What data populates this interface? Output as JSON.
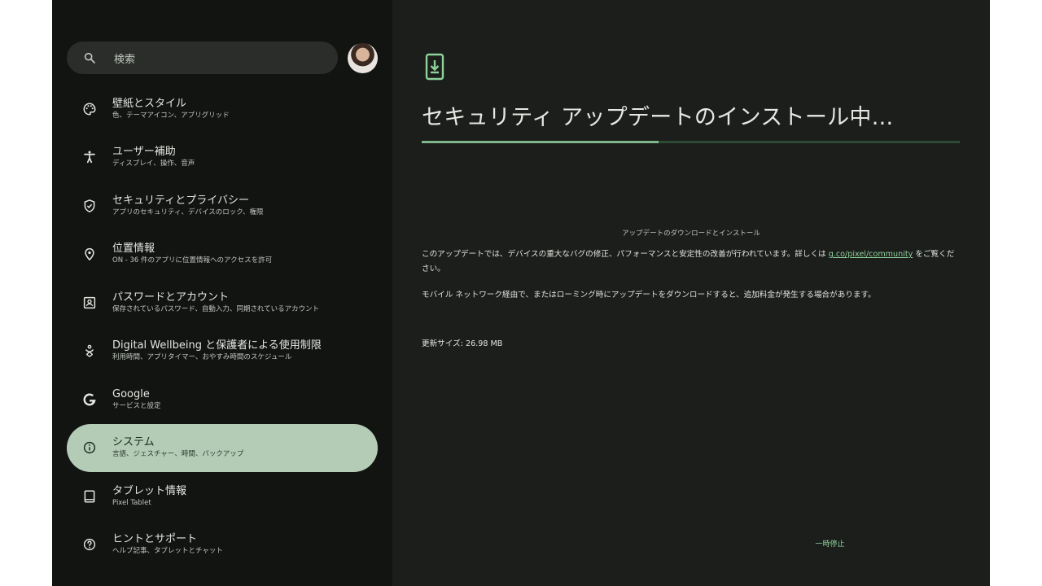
{
  "search": {
    "placeholder": "検索"
  },
  "sidebar": {
    "items": [
      {
        "title": "壁紙とスタイル",
        "subtitle": "色、テーマアイコン、アプリグリッド",
        "icon": "palette-icon"
      },
      {
        "title": "ユーザー補助",
        "subtitle": "ディスプレイ、操作、音声",
        "icon": "accessibility-icon"
      },
      {
        "title": "セキュリティとプライバシー",
        "subtitle": "アプリのセキュリティ、デバイスのロック、権限",
        "icon": "shield-icon"
      },
      {
        "title": "位置情報",
        "subtitle": "ON - 36 件のアプリに位置情報へのアクセスを許可",
        "icon": "location-pin-icon"
      },
      {
        "title": "パスワードとアカウント",
        "subtitle": "保存されているパスワード、自動入力、同期されているアカウント",
        "icon": "account-box-icon"
      },
      {
        "title": "Digital Wellbeing と保護者による使用制限",
        "subtitle": "利用時間、アプリタイマー、おやすみ時間のスケジュール",
        "icon": "wellbeing-icon"
      },
      {
        "title": "Google",
        "subtitle": "サービスと設定",
        "icon": "google-g-icon"
      },
      {
        "title": "システム",
        "subtitle": "言語、ジェスチャー、時間、バックアップ",
        "icon": "info-icon",
        "active": true
      },
      {
        "title": "タブレット情報",
        "subtitle": "Pixel Tablet",
        "icon": "tablet-icon"
      },
      {
        "title": "ヒントとサポート",
        "subtitle": "ヘルプ記事、タブレットとチャット",
        "icon": "help-icon"
      }
    ]
  },
  "update": {
    "title": "セキュリティ アップデートのインストール中...",
    "progress": 0.44,
    "subtitle": "アップデートのダウンロードとインストール",
    "description_before": "このアップデートでは、デバイスの重大なバグの修正、パフォーマンスと安定性の改善が行われています。詳しくは ",
    "description_link": "g.co/pixel/community",
    "description_after": " をご覧ください。",
    "warning": "モバイル ネットワーク経由で、またはローミング時にアップデートをダウンロードすると、追加料金が発生する場合があります。",
    "size": "更新サイズ: 26.98 MB",
    "pause_label": "一時停止"
  },
  "colors": {
    "accent": "#8fd19a",
    "active_item_bg": "#b4cbb6",
    "sidebar_bg": "#121412",
    "content_bg": "#1b1e1b"
  }
}
